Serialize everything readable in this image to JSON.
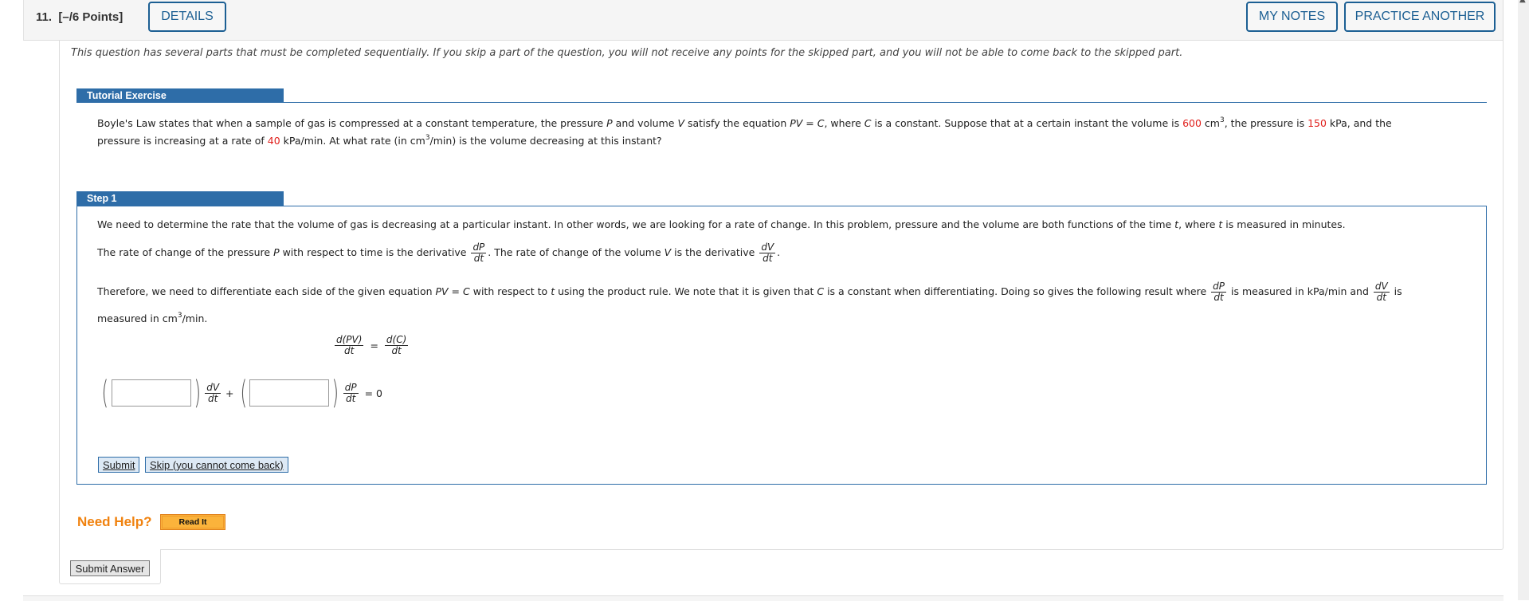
{
  "header": {
    "question_number": "11.",
    "points": "[–/6 Points]",
    "details_label": "DETAILS",
    "my_notes_label": "MY NOTES",
    "practice_another_label": "PRACTICE ANOTHER"
  },
  "note": "This question has several parts that must be completed sequentially. If you skip a part of the question, you will not receive any points for the skipped part, and you will not be able to come back to the skipped part.",
  "tutorial": {
    "title": "Tutorial Exercise",
    "line1_a": "Boyle's Law states that when a sample of gas is compressed at a constant temperature, the pressure ",
    "P": "P",
    "line1_b": " and volume ",
    "V": "V",
    "line1_c": " satisfy the equation ",
    "eq": "PV = C",
    "line1_d": ", where ",
    "C": "C",
    "line1_e": " is a constant. Suppose that at a certain instant the volume is ",
    "volume": "600",
    "line1_f": " cm",
    "sup3": "3",
    "line1_g": ", the pressure is ",
    "pressure": "150",
    "line1_h": " kPa, and the",
    "line2_a": "pressure is increasing at a rate of ",
    "rate": "40",
    "line2_b": " kPa/min. At what rate (in cm",
    "line2_c": "/min) is the volume decreasing at this instant?",
    "colors": {
      "highlight": "#e0201c",
      "bar": "#2e6da8"
    }
  },
  "step1": {
    "title": "Step 1",
    "p1_a": "We need to determine the rate that the volume of gas is decreasing at a particular instant. In other words, we are looking for a rate of change. In this problem, pressure and the volume are both functions of the time ",
    "t": "t",
    "p1_b": ", where ",
    "p1_c": " is measured in minutes.",
    "p2_a": "The rate of change of the pressure ",
    "p2_b": " with respect to time is the derivative ",
    "p2_c": ". The rate of change of the volume ",
    "p2_d": " is the derivative ",
    "p2_e": ".",
    "p3_a": "Therefore, we need to differentiate each side of the given equation ",
    "p3_b": " with respect to ",
    "p3_c": " using the product rule. We note that it is given that ",
    "p3_d": " is a constant when differentiating. Doing so gives the following result where ",
    "p3_e": " is measured in kPa/min and ",
    "p3_f": " is",
    "p4_a": "measured in cm",
    "p4_b": "/min.",
    "dP": "dP",
    "dV": "dV",
    "dt": "dt",
    "dPV": "d(PV)",
    "dC": "d(C)",
    "equals": "=",
    "plus": "+",
    "equals_zero": "= 0",
    "answer1_value": "",
    "answer2_value": "",
    "submit_label": "Submit",
    "skip_label": "Skip (you cannot come back)"
  },
  "help": {
    "label": "Need Help?",
    "read_it_label": "Read It"
  },
  "submit_answer_label": "Submit Answer"
}
